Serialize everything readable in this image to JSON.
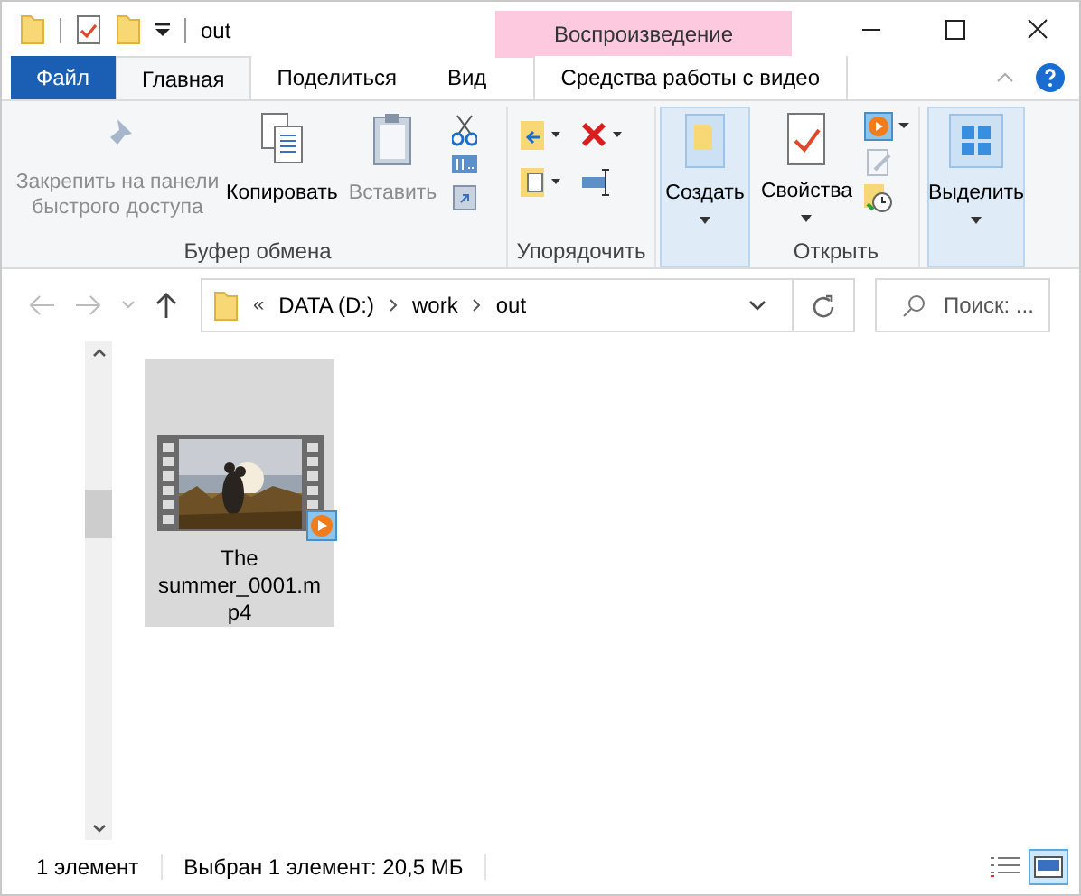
{
  "window": {
    "title": "out"
  },
  "context_tab": {
    "label": "Воспроизведение"
  },
  "tabs": [
    {
      "label": "Файл",
      "kind": "file",
      "selected": false
    },
    {
      "label": "Главная",
      "kind": "tab",
      "selected": true
    },
    {
      "label": "Поделиться",
      "kind": "tab",
      "selected": false
    },
    {
      "label": "Вид",
      "kind": "tab",
      "selected": false
    },
    {
      "label": "Средства работы с видео",
      "kind": "context",
      "selected": false
    }
  ],
  "ribbon": {
    "clipboard": {
      "pin": {
        "label": "Закрепить на панели быстрого доступа",
        "disabled": true
      },
      "copy": {
        "label": "Копировать",
        "disabled": false
      },
      "paste": {
        "label": "Вставить",
        "disabled": true
      },
      "group_label": "Буфер обмена"
    },
    "organize": {
      "group_label": "Упорядочить"
    },
    "create": {
      "label": "Создать"
    },
    "open": {
      "label": "Свойства",
      "group_label": "Открыть"
    },
    "select": {
      "label": "Выделить"
    }
  },
  "address": {
    "prefix": "«",
    "path": [
      "DATA (D:)",
      "work",
      "out"
    ]
  },
  "search": {
    "placeholder": "Поиск: ..."
  },
  "files": [
    {
      "name_lines": [
        "The",
        "summer_0001.m",
        "p4"
      ],
      "selected": true
    }
  ],
  "status_bar": {
    "count": "1 элемент",
    "selection": "Выбран 1 элемент: 20,5 МБ"
  },
  "views": [
    {
      "kind": "details",
      "selected": false
    },
    {
      "kind": "large",
      "selected": true
    }
  ]
}
